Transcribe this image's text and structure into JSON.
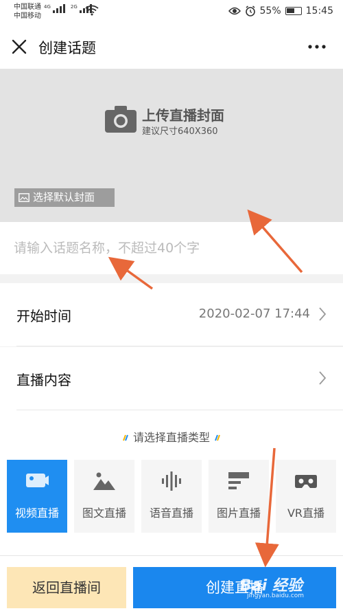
{
  "status_bar": {
    "carrier_1": "中国联通",
    "carrier_2": "中国移动",
    "network_1": "4G",
    "network_2": "2G",
    "battery": "55%",
    "time": "15:45"
  },
  "nav": {
    "title": "创建话题"
  },
  "cover": {
    "upload_title": "上传直播封面",
    "upload_subtitle": "建议尺寸640X360",
    "default_cover_label": "选择默认封面"
  },
  "topic_name": {
    "placeholder": "请输入话题名称，不超过40个字",
    "value": ""
  },
  "rows": {
    "start_time": {
      "label": "开始时间",
      "value": "2020-02-07 17:44"
    },
    "content": {
      "label": "直播内容"
    }
  },
  "live_type": {
    "heading": "请选择直播类型",
    "options": [
      {
        "label": "视频直播",
        "icon": "video-camera-icon",
        "selected": true
      },
      {
        "label": "图文直播",
        "icon": "mountain-image-icon",
        "selected": false
      },
      {
        "label": "语音直播",
        "icon": "sound-wave-icon",
        "selected": false
      },
      {
        "label": "图片直播",
        "icon": "picture-text-icon",
        "selected": false
      },
      {
        "label": "VR直播",
        "icon": "vr-headset-icon",
        "selected": false
      }
    ]
  },
  "actions": {
    "back_label": "返回直播间",
    "create_label": "创建直播"
  },
  "watermark": {
    "brand": "Bai 经验",
    "url": "jingyan.baidu.com"
  },
  "colors": {
    "primary_blue": "#1a87ee",
    "selected_blue": "#1f8ef1",
    "back_button_bg": "#fde6b6",
    "annotation_arrow": "#e8683a"
  }
}
